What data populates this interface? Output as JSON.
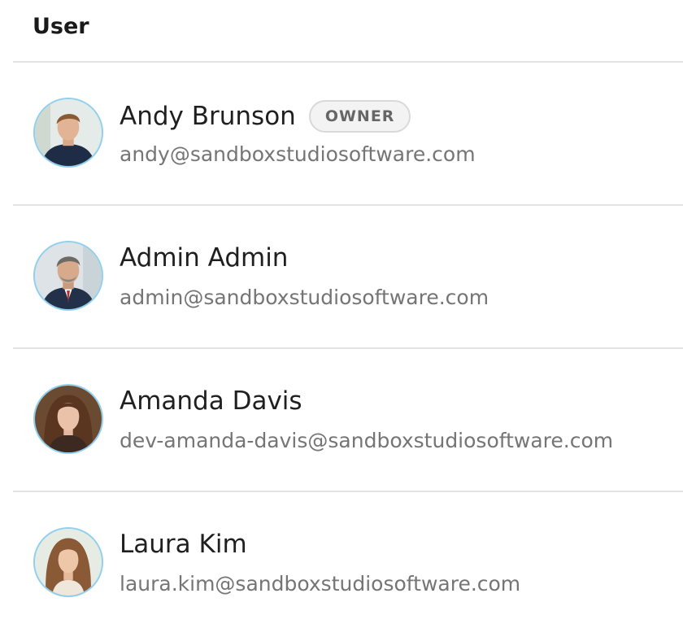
{
  "header": {
    "column_label": "User"
  },
  "users": [
    {
      "name": "Andy Brunson",
      "email": "andy@sandboxstudiosoftware.com",
      "badge": "OWNER",
      "avatar_icon": "avatar-man-young"
    },
    {
      "name": "Admin Admin",
      "email": "admin@sandboxstudiosoftware.com",
      "badge": "",
      "avatar_icon": "avatar-man-gray-hair"
    },
    {
      "name": "Amanda Davis",
      "email": "dev-amanda-davis@sandboxstudiosoftware.com",
      "badge": "",
      "avatar_icon": "avatar-woman-brunette"
    },
    {
      "name": "Laura Kim",
      "email": "laura.kim@sandboxstudiosoftware.com",
      "badge": "",
      "avatar_icon": "avatar-woman-long-hair"
    }
  ],
  "colors": {
    "avatar_ring": "#8fd0ee",
    "divider": "#e3e3e3",
    "badge_bg": "#f3f3f3",
    "email_text": "#757575"
  }
}
